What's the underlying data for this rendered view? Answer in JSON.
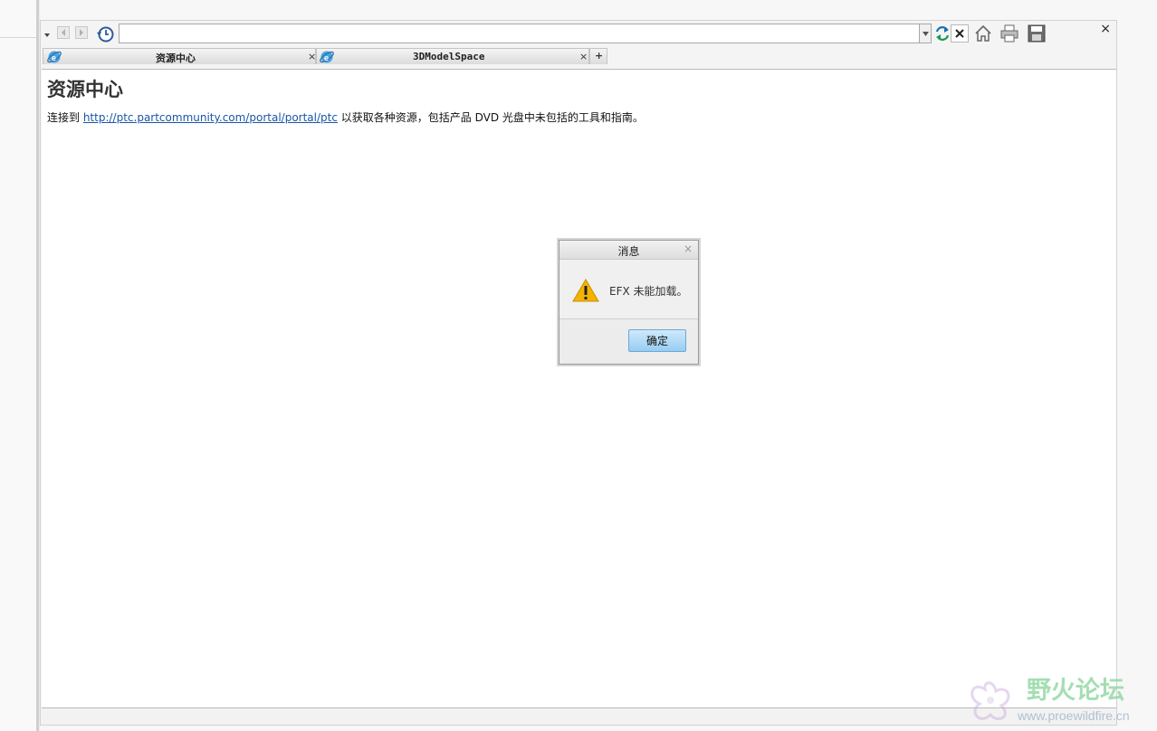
{
  "toolbar": {
    "url_value": "",
    "close_panel": "×"
  },
  "tabs": [
    {
      "label": "资源中心",
      "close": "×"
    },
    {
      "label": "3DModelSpace",
      "close": "×"
    }
  ],
  "new_tab": "+",
  "page": {
    "heading": "资源中心",
    "prefix": "连接到 ",
    "link": "http://ptc.partcommunity.com/portal/portal/ptc",
    "suffix": " 以获取各种资源，包括产品 DVD 光盘中未包括的工具和指南。"
  },
  "dialog": {
    "title": "消息",
    "close": "×",
    "message": "EFX 未能加载。",
    "ok_label": "确定"
  },
  "watermark": {
    "text": "野火论坛",
    "url": "www.proewildfire.cn"
  },
  "colors": {
    "link": "#1a57a6",
    "accent": "#97cdf2",
    "warning": "#f2b400"
  }
}
